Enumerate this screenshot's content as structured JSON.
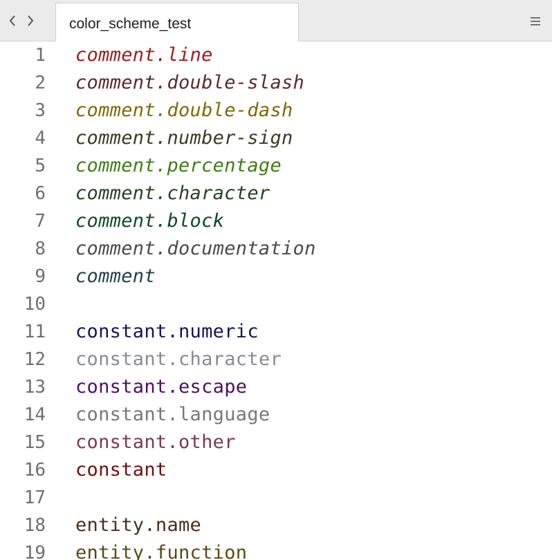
{
  "tab": {
    "title": "color_scheme_test"
  },
  "lines": [
    {
      "num": "1",
      "text": "comment.line",
      "color": "#9b1c1c",
      "italic": true
    },
    {
      "num": "2",
      "text": "comment.double-slash",
      "color": "#5a2a2a",
      "italic": true
    },
    {
      "num": "3",
      "text": "comment.double-dash",
      "color": "#7f6a00",
      "italic": true
    },
    {
      "num": "4",
      "text": "comment.number-sign",
      "color": "#3b3a24",
      "italic": true
    },
    {
      "num": "5",
      "text": "comment.percentage",
      "color": "#3f7d14",
      "italic": true
    },
    {
      "num": "6",
      "text": "comment.character",
      "color": "#244224",
      "italic": true
    },
    {
      "num": "7",
      "text": "comment.block",
      "color": "#0d4a23",
      "italic": true
    },
    {
      "num": "8",
      "text": "comment.documentation",
      "color": "#4a4a4a",
      "italic": true
    },
    {
      "num": "9",
      "text": "comment",
      "color": "#1f3f4a",
      "italic": true
    },
    {
      "num": "10",
      "text": "",
      "color": "#000000",
      "italic": false
    },
    {
      "num": "11",
      "text": "constant.numeric",
      "color": "#14145e",
      "italic": false
    },
    {
      "num": "12",
      "text": "constant.character",
      "color": "#8a8a92",
      "italic": false
    },
    {
      "num": "13",
      "text": "constant.escape",
      "color": "#4e0f5e",
      "italic": false
    },
    {
      "num": "14",
      "text": "constant.language",
      "color": "#777777",
      "italic": false
    },
    {
      "num": "15",
      "text": "constant.other",
      "color": "#7a3a52",
      "italic": false
    },
    {
      "num": "16",
      "text": "constant",
      "color": "#6e0f0f",
      "italic": false
    },
    {
      "num": "17",
      "text": "",
      "color": "#000000",
      "italic": false
    },
    {
      "num": "18",
      "text": "entity.name",
      "color": "#4a2e1c",
      "italic": false
    },
    {
      "num": "19",
      "text": "entity.function",
      "color": "#5b4a10",
      "italic": false
    }
  ],
  "icons": {
    "back": "chevron-left-icon",
    "forward": "chevron-right-icon",
    "menu": "hamburger-menu-icon"
  }
}
